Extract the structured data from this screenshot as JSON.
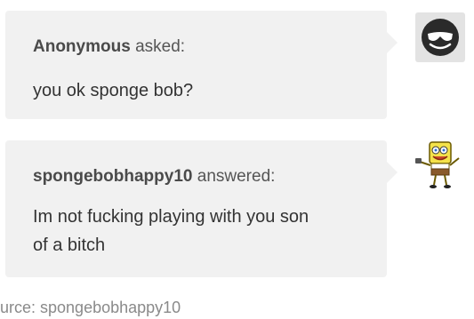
{
  "question": {
    "asker": "Anonymous",
    "verb": "asked:",
    "text": "you ok sponge bob?"
  },
  "answer": {
    "answerer": "spongebobhappy10",
    "verb": "answered:",
    "lines": [
      "Im not fucking playing with you son",
      "of a bitch"
    ]
  },
  "footer": {
    "source": "ource: spongebobhappy10"
  },
  "icons": {
    "asker_avatar": "anonymous-sunglasses-avatar-icon",
    "answerer_avatar": "spongebob-avatar-icon"
  }
}
